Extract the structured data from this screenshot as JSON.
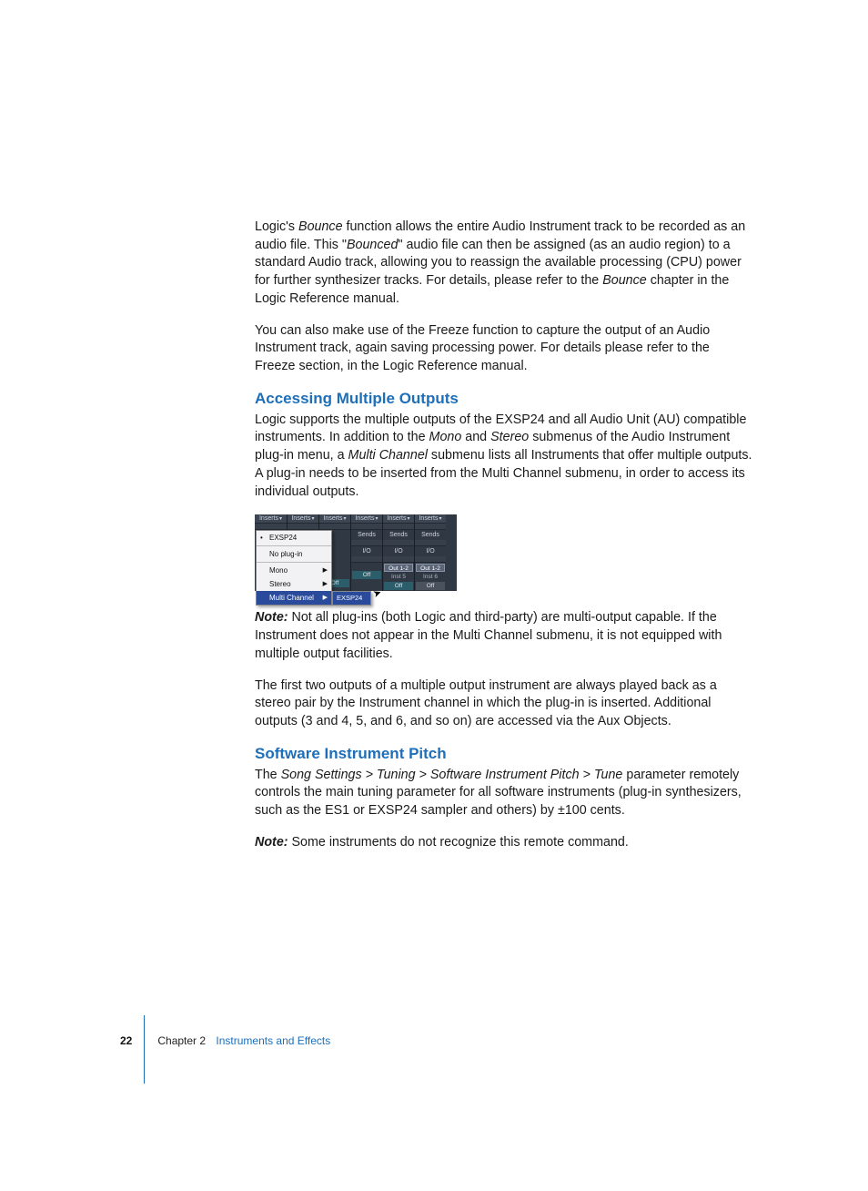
{
  "p1": {
    "pre": "Logic's ",
    "i1": "Bounce",
    "mid1": " function allows the entire Audio Instrument track to be recorded as an audio file. This \"",
    "i2": "Bounced",
    "mid2": "\" audio file can then be assigned (as an audio region) to a standard Audio track, allowing you to reassign the available processing (CPU) power for further synthesizer tracks. For details, please refer to the ",
    "i3": "Bounce",
    "post": " chapter in the Logic Reference manual."
  },
  "p2": "You can also make use of the Freeze function to capture the output of an Audio Instrument track, again saving processing power. For details please refer to the Freeze section, in the Logic Reference manual.",
  "h_a": "Accessing Multiple Outputs",
  "p3": {
    "pre": "Logic supports the multiple outputs of the EXSP24 and all Audio Unit (AU) compatible instruments. In addition to the ",
    "i1": "Mono",
    "mid1": " and ",
    "i2": "Stereo",
    "mid2": " submenus of the Audio Instrument plug-in menu, a ",
    "i3": "Multi Channel",
    "post": " submenu lists all Instruments that offer multiple outputs. A plug-in needs to be inserted from the Multi Channel submenu, in order to access its individual outputs."
  },
  "note1": {
    "label": "Note:  ",
    "text": "Not all plug-ins (both Logic and third-party) are multi-output capable. If the Instrument does not appear in the Multi Channel submenu, it is not equipped with multiple output facilities."
  },
  "p4": "The first two outputs of a multiple output instrument are always played back as a stereo pair by the Instrument channel in which the plug-in is inserted. Additional outputs (3 and 4, 5, and 6, and so on) are accessed via the Aux Objects.",
  "h_b": "Software Instrument Pitch",
  "p5": {
    "pre": "The ",
    "i1": "Song Settings > Tuning > Software Instrument Pitch > Tune",
    "post": " parameter remotely controls the main tuning parameter for all software instruments (plug-in synthesizers, such as the ES1 or EXSP24 sampler and others) by ±100 cents."
  },
  "note2": {
    "label": "Note:  ",
    "text": "Some instruments do not recognize this remote command."
  },
  "footer": {
    "page": "22",
    "chapter": "Chapter 2",
    "title": "Instruments and Effects"
  },
  "fig": {
    "inserts": "Inserts",
    "sends": "Sends",
    "io": "I/O",
    "out12": "Out 1-2",
    "inst5": "Inst 5",
    "inst6": "Inst 6",
    "off": "Off",
    "menu": {
      "exsp24": "EXSP24",
      "noplugin": "No plug-in",
      "mono": "Mono",
      "stereo": "Stereo",
      "multi": "Multi Channel",
      "sub_exsp24": "EXSP24"
    }
  }
}
